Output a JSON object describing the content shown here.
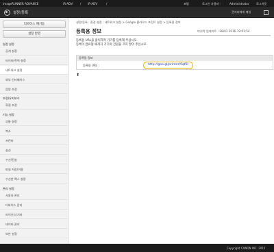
{
  "header": {
    "product": "imageRUNNER ADVANCE",
    "device1": "iR-ADV",
    "device2": "iR-ADV",
    "separator": "/",
    "home_label": "포털",
    "login_label": "로그인 사용자 :",
    "user": "Administrator",
    "logout_label": "로그아웃"
  },
  "subheader": {
    "title": "설정/등록",
    "manager_label": "관리자에게 메일"
  },
  "sidebar": {
    "top_buttons": [
      "디바이스 재기동",
      "설정 반영"
    ],
    "sections": [
      {
        "title": "설정 설정",
        "items": [
          {
            "label": "공개 설정"
          },
          {
            "label": "타이머/전력 설정"
          },
          {
            "label": "네트워크 설정",
            "active": true
          },
          {
            "label": "외부 인터페이스"
          },
          {
            "label": "음량 조정"
          }
        ]
      },
      {
        "title": "조정/유지보수",
        "items": [
          {
            "label": "화질 조정"
          }
        ]
      },
      {
        "title": "기능 설정",
        "items": [
          {
            "label": "공통 설정"
          },
          {
            "label": "복사"
          },
          {
            "label": "프린터"
          },
          {
            "label": "송신"
          },
          {
            "label": "수신/전송"
          },
          {
            "label": "파일 저장/이용"
          },
          {
            "label": "수신한 팩스 설정"
          }
        ]
      },
      {
        "title": "관리 설정",
        "items": [
          {
            "label": "사용자 관리"
          },
          {
            "label": "디바이스 관리"
          },
          {
            "label": "라이선스/기타"
          },
          {
            "label": "데이터 관리"
          },
          {
            "label": "보안 설정"
          }
        ]
      }
    ]
  },
  "main": {
    "breadcrumb": "설정/등록 : 환경 설정 : 네트워크 설정 > Google 클라우드 프린트 설정 > 등록용 정보",
    "title": "등록용 정보",
    "updated": "마지막 업데이트 : 28/03 2016 19:01:54",
    "message1": "등록용 URL을 클릭하여 기기를 등록해 주십시오.",
    "message2": "등록이 완료될 때까지 기기의 전원을 끄지 말아 주십시오.",
    "panel_title": "등록용 정보",
    "url_label": "등록용 URL :",
    "url_value": "http://goo.gl/printer/9qf6l",
    "up_icon": "up-arrow-icon"
  },
  "footer": {
    "copyright": "Copyright CANON INC. 2015"
  },
  "colors": {
    "header_bg": "#1b1b1b",
    "highlight_border": "#f2b500",
    "link": "#1c3fbf"
  }
}
